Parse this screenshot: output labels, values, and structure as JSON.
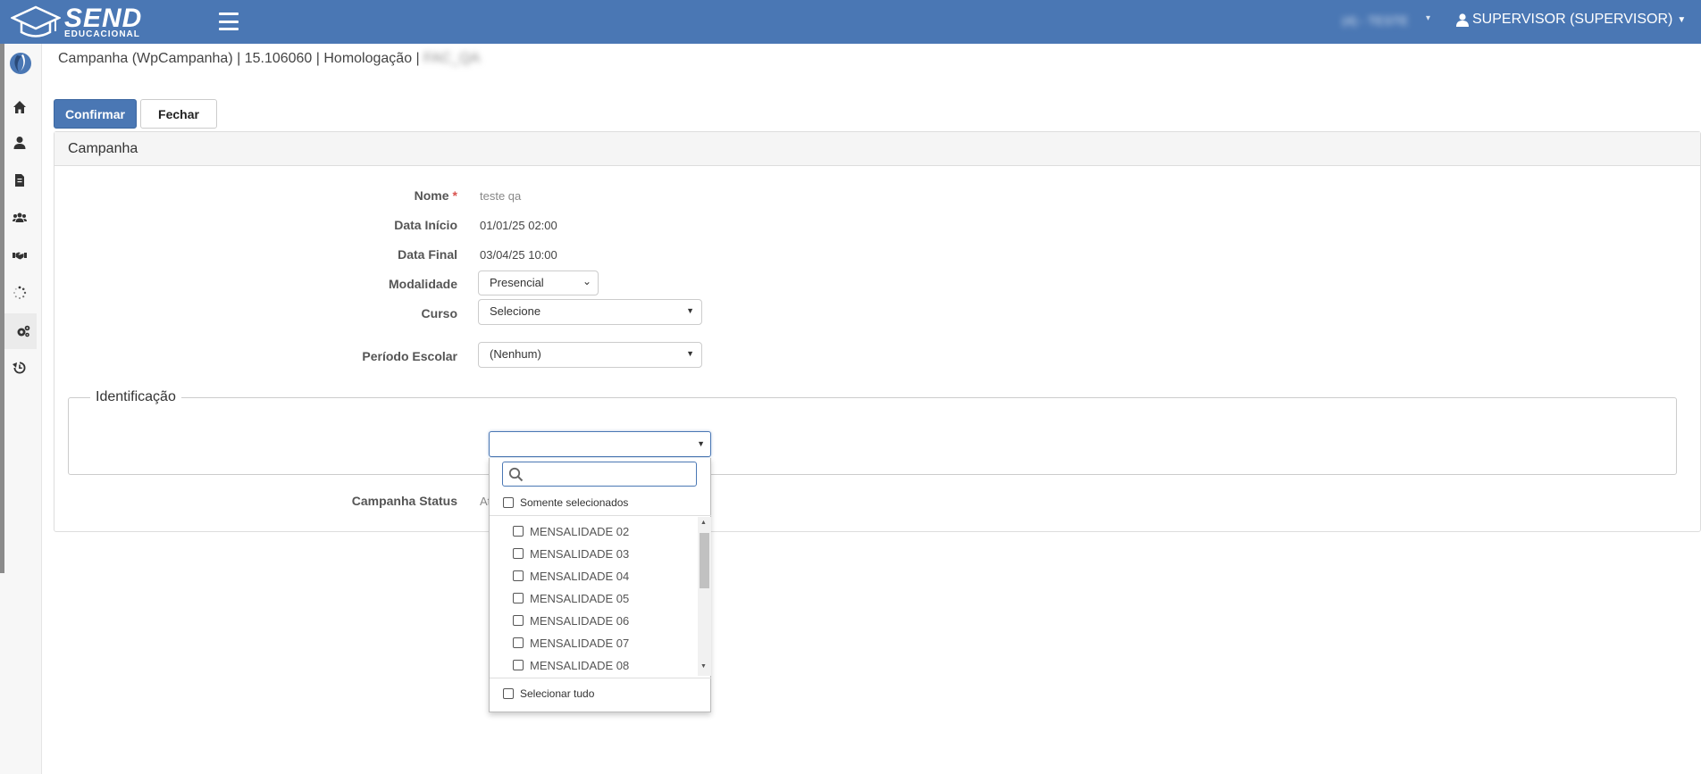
{
  "header": {
    "brand_name": "SEND",
    "brand_sub": "EDUCACIONAL",
    "env_label": "(4) - TESTE",
    "user_label": "SUPERVISOR (SUPERVISOR)"
  },
  "sidebar": {
    "items": [
      {
        "icon": "home-icon"
      },
      {
        "icon": "user-icon"
      },
      {
        "icon": "document-icon"
      },
      {
        "icon": "users-icon"
      },
      {
        "icon": "handshake-icon"
      },
      {
        "icon": "spinner-icon"
      },
      {
        "icon": "gears-icon",
        "active": true
      },
      {
        "icon": "history-icon"
      }
    ]
  },
  "breadcrumb": {
    "text": "Campanha (WpCampanha) | 15.106060 | Homologação |",
    "blurred": "FAC_QA"
  },
  "toolbar": {
    "confirm_label": "Confirmar",
    "close_label": "Fechar"
  },
  "panel": {
    "title": "Campanha",
    "fields": {
      "nome_label": "Nome",
      "nome_req": "*",
      "nome_value": "teste qa",
      "data_inicio_label": "Data Início",
      "data_inicio_value": "01/01/25 02:00",
      "data_final_label": "Data Final",
      "data_final_value": "03/04/25 10:00",
      "modalidade_label": "Modalidade",
      "modalidade_value": "Presencial",
      "curso_label": "Curso",
      "curso_value": "Selecione",
      "periodo_label": "Período Escolar",
      "periodo_value": "(Nenhum)",
      "status_label": "Campanha Status",
      "status_value": "At"
    },
    "identificacao": {
      "legend": "Identificação",
      "dropdown": {
        "only_selected_label": "Somente selecionados",
        "select_all_label": "Selecionar tudo",
        "items": [
          "MENSALIDADE 02",
          "MENSALIDADE 03",
          "MENSALIDADE 04",
          "MENSALIDADE 05",
          "MENSALIDADE 06",
          "MENSALIDADE 07",
          "MENSALIDADE 08"
        ]
      }
    }
  },
  "colors": {
    "primary": "#4a77b4",
    "required": "#d9534f"
  }
}
